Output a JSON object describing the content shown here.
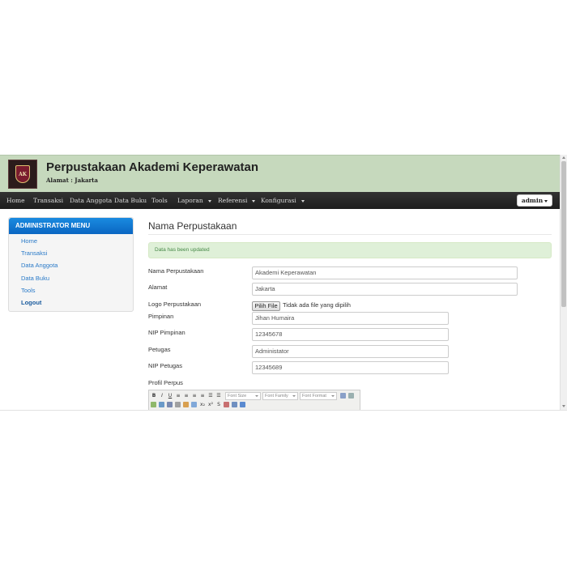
{
  "header": {
    "title": "Perpustakaan Akademi Keperawatan",
    "address": "Alamat : Jakarta",
    "logo_icon": "library-crest-logo"
  },
  "navbar": {
    "items": [
      "Home",
      "Transaksi",
      "Data Anggota",
      "Data Buku",
      "Tools",
      "Laporan",
      "Referensi",
      "Konfigurasi"
    ],
    "user_button": "admin"
  },
  "sidebar": {
    "title": "ADMINISTRATOR MENU",
    "items": [
      "Home",
      "Transaksi",
      "Data Anggota",
      "Data Buku",
      "Tools",
      "Logout"
    ]
  },
  "main": {
    "heading": "Nama Perpustakaan",
    "alert": "Data has been updated",
    "form": {
      "nama_label": "Nama Perpustakaan",
      "nama_value": "Akademi Keperawatan",
      "alamat_label": "Alamat",
      "alamat_value": "Jakarta",
      "logo_label": "Logo Perpustakaan",
      "file_button": "Pilih File",
      "file_status": "Tidak ada file yang dipilih",
      "pimpinan_label": "Pimpinan",
      "pimpinan_value": "Jihan Humaira",
      "nip_pimpinan_label": "NIP Pimpinan",
      "nip_pimpinan_value": "12345678",
      "petugas_label": "Petugas",
      "petugas_value": "Administator",
      "nip_petugas_label": "NIP Petugas",
      "nip_petugas_value": "12345689",
      "profil_label": "Profil Perpus"
    },
    "editor": {
      "font_size": "Font Size",
      "font_family": "Font Family",
      "font_format": "Font Format"
    }
  },
  "colors": {
    "header_bg": "#c6d9bd",
    "navbar_bg": "#222222",
    "sidebar_header": "#0a66c2",
    "link": "#2a7ac8",
    "alert_bg": "#dff0d8",
    "alert_text": "#468847"
  }
}
